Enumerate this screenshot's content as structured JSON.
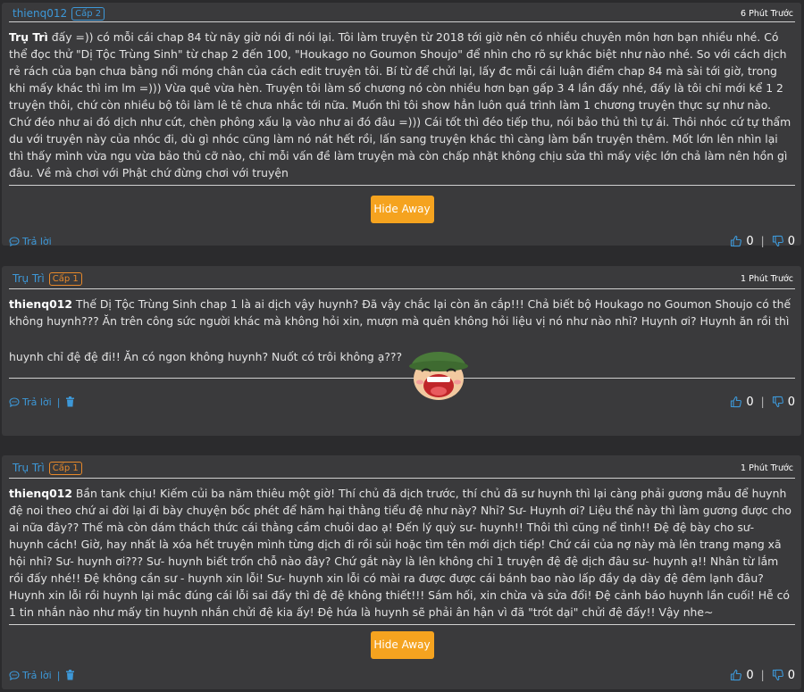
{
  "comments": [
    {
      "author": "thienq012",
      "level": "Cấp 2",
      "time": "6 Phút Trước",
      "mention": "Trụ Trì",
      "text": " đấy =)) có mỗi cái chap 84 từ nãy giờ nói đi nói lại. Tôi làm truyện từ 2018 tới giờ nên có nhiều chuyên môn hơn bạn nhiều nhé. Có thể đọc thử \"Dị Tộc Trùng Sinh\" từ chap 2 đến 100, \"Houkago no Goumon Shoujo\" để nhìn cho rõ sự khác biệt như nào nhé. So với cách dịch rẻ rách của bạn chưa bằng nổi móng chân của cách edit truyện tôi. Bí từ để chửi lại, lấy đc mỗi cái luận điểm chap 84 mà sài tới giờ, trong khi mấy khác thì im lm =))) Vừa quê vừa hèn. Truyện tôi làm số chương nó còn nhiều hơn bạn gấp 3 4 lần đấy nhé, đấy là tôi chỉ mới kể 1 2 truyện thôi, chứ còn nhiều bộ tôi làm lê tê chưa nhắc tới nữa. Muốn thì tôi show hẳn luôn quá trình làm 1 chương truyện thực sự như nào. Chứ đéo như ai đó dịch như cứt, chèn phông xấu lạ vào như ai đó đâu =))) Cái tốt thì đéo tiếp thu, nói bảo thủ thì tự ái. Thôi nhóc cứ tự thẩm du với truyện này của nhóc đi, dù gì nhóc cũng làm nó nát hết rồi, lấn sang truyện khác thì càng làm bẩn truyện thêm. Mốt lớn lên nhìn lại thì thấy mình vừa ngu vừa bảo thủ cỡ nào, chỉ mỗi vấn đề làm truyện mà còn chấp nhặt không chịu sửa thì mấy việc lớn chả làm nên hồn gì đâu. Về mà chơi với Phật chứ đừng chơi với truyện",
      "hide_label": "Hide Away",
      "reply_label": "Trả lời",
      "likes": "0",
      "dislikes": "0"
    },
    {
      "author": "Trụ Trì",
      "level": "Cấp 1",
      "time": "1 Phút Trước",
      "mention": "thienq012",
      "text": " Thế Dị Tộc Trùng Sinh chap 1 là ai dịch vậy huynh? Đã vậy chắc lại còn ăn cắp!!! Chả biết bộ Houkago no Goumon Shoujo có thế không huynh??? Ăn trên công sức người khác mà không hỏi xin, mượn mà quên không hỏi liệu vị nó như nào nhỉ? Huynh ơi? Huynh ăn rồi thì",
      "text2": "huynh chỉ đệ đệ đi!! Ăn có ngon không huynh? Nuốt có trôi không ạ???",
      "reply_label": "Trả lời",
      "likes": "0",
      "dislikes": "0"
    },
    {
      "author": "Trụ Trì",
      "level": "Cấp 1",
      "time": "1 Phút Trước",
      "mention": "thienq012",
      "text": " Bần tank chịu! Kiếm củi ba năm thiêu một giờ! Thí chủ đã dịch trước, thí chủ đã sư huynh thì lại càng phải gương mẫu để huynh đệ noi theo chứ ai đời lại đi bày chuyện bốc phét để hãm hại thằng tiểu đệ như này? Nhỉ? Sư- Huynh ơi? Liệu thế này thì làm gương được cho ai nữa đây?? Thế mà còn dám thách thức cái thằng cầm chuôi dao ạ! Đến lý quỳ sư- huynh!! Thôi thì cũng nể tình!! Đệ đệ bày cho sư- huynh cách! Giờ, hay nhất là xóa hết truyện mình từng dịch đi rồi sủi hoặc tìm tên mới dịch tiếp! Chứ cái của nợ này mà lên trang mạng xã hội nhỉ? Sư- huynh ơi??? Sư- huynh biết trốn chỗ nào đây? Chứ gắt này là lên không chỉ 1 truyện đệ đệ dịch đâu sư- huynh ạ!! Nhân từ lắm rồi đấy nhé!! Đệ không cần sư - huynh xin lỗi! Sư- huynh xin lỗi có mài ra được được cái bánh bao nào lấp đầy dạ dày đệ đêm lạnh đâu? Huynh xin lỗi rồi huynh lại mắc đúng cái lỗi sai đấy thì đệ đệ không thiết!!! Sám hối, xin chừa và sửa đổi! Đệ cảnh báo huynh lần cuối! Hễ có 1 tin nhắn nào như mấy tin huynh nhắn chửi đệ kia ấy! Đệ hứa là huynh sẽ phải ân hận vì đã \"trót dại\" chửi đệ đấy!! Vậy nhe~",
      "hide_label": "Hide Away",
      "reply_label": "Trả lời",
      "likes": "0",
      "dislikes": "0"
    }
  ],
  "colors": {
    "accent_blue": "#3d98d8",
    "level_orange": "#e8892a",
    "hide_button": "#f5a31f"
  },
  "icons": {
    "reply": "speech-bubble-icon",
    "like": "thumbs-up-icon",
    "dislike": "thumbs-down-icon",
    "delete": "trash-icon",
    "emoji": "laughing-soldier-emoji"
  }
}
